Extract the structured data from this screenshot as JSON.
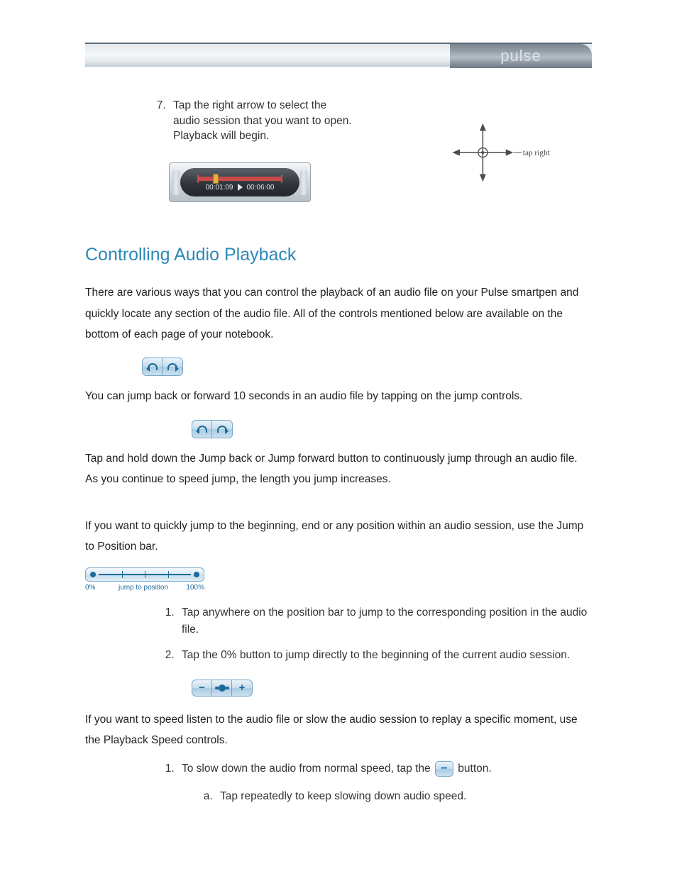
{
  "header": {
    "logo": "pulse"
  },
  "step7": {
    "number": "7",
    "text": "Tap the right arrow to select the audio session that you want to open. Playback will begin.",
    "player": {
      "elapsed": "00:01:09",
      "total": "00:06:00"
    },
    "nav_hint": "tap right"
  },
  "section": {
    "title": "Controlling Audio Playback",
    "intro": "There are various ways that you can control the playback of an audio file on your Pulse smartpen and quickly locate any section of the audio file. All of the controls mentioned below are available on the bottom of each page of your notebook.",
    "jump_p1": "You can jump back or forward 10 seconds in an audio file by tapping on the jump controls.",
    "jump_p2": "Tap and hold down the Jump back or Jump forward button to continuously jump through an audio file.  As you continue to speed jump, the length you jump increases.",
    "pos_intro": "If you want to quickly jump to the beginning, end or any position within an audio session, use the Jump to Position bar.",
    "pos_bar": {
      "left": "0%",
      "mid": "jump to position",
      "right": "100%"
    },
    "pos_steps": [
      "Tap anywhere on the position bar to jump to the corresponding position in the audio file.",
      "Tap the 0% button to jump directly to the beginning of the current audio session."
    ],
    "speed_intro": "If you want to speed listen to the audio file or slow the audio session to replay a specific moment, use the Playback Speed controls.",
    "speed_step1_a": "To slow down the audio from normal speed, tap the ",
    "speed_step1_b": " button.",
    "speed_sub_a": "Tap repeatedly to keep slowing down audio speed."
  }
}
